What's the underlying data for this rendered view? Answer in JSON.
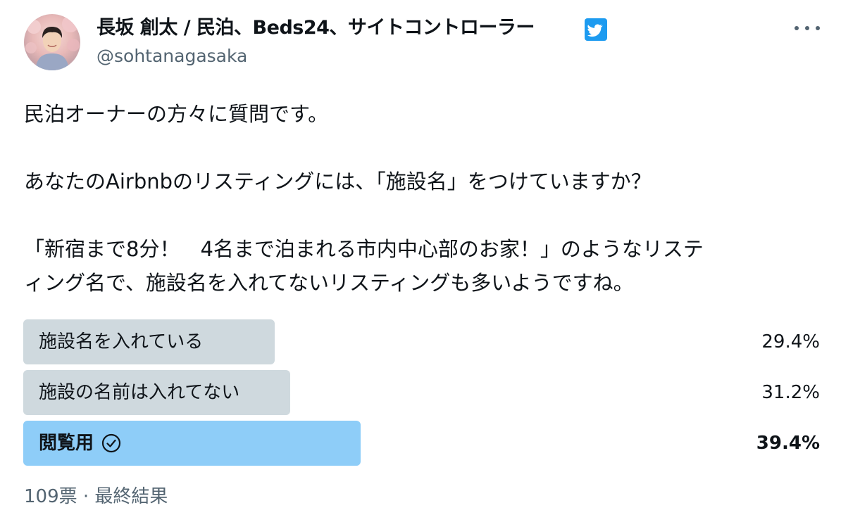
{
  "author": {
    "display_name": "長坂 創太 / 民泊、Beds24、サイトコントローラー",
    "handle": "@sohtanagasaka",
    "verified": true
  },
  "tweet": {
    "lines": [
      "民泊オーナーの方々に質問です。",
      "あなたのAirbnbのリスティングには、「施設名」をつけていますか？",
      "「新宿まで8分！　4名まで泊まれる市内中心部のお家！」のようなリステ",
      "ィング名で、施設名を入れてないリスティングも多いようですね。"
    ]
  },
  "poll": {
    "options": [
      {
        "label": "施設名を入れている",
        "percent_text": "29.4%",
        "fill": 0.294,
        "winner": false
      },
      {
        "label": "施設の名前は入れてない",
        "percent_text": "31.2%",
        "fill": 0.312,
        "winner": false
      },
      {
        "label": "閲覧用",
        "percent_text": "39.4%",
        "fill": 0.394,
        "winner": true
      }
    ],
    "footer": "109票 · 最終結果"
  },
  "icons": {
    "verified": "verified-badge-icon",
    "more": "more-dots-icon",
    "winner_check": "check-circle-icon"
  },
  "colors": {
    "accent": "#1d9bf0",
    "bar": "#cfd9de",
    "bar_winner": "#8ecdf8",
    "secondary_text": "#536471"
  }
}
